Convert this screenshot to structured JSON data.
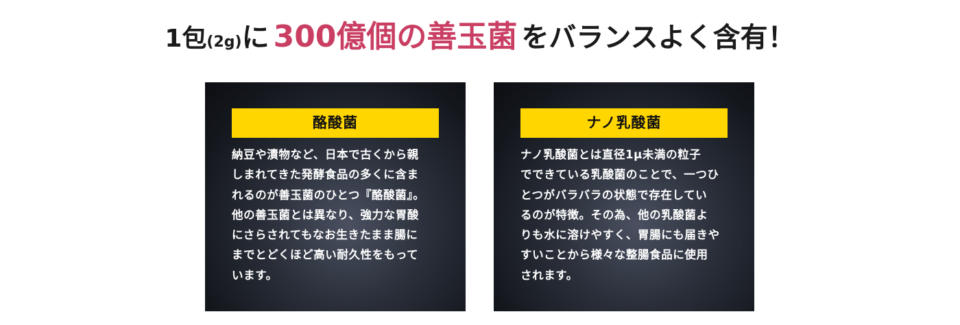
{
  "headline": {
    "part1": "1包",
    "part2": "(2g)",
    "part3": "に",
    "accent": "300億個の善玉菌",
    "part4": "をバランスよく含有！"
  },
  "colors": {
    "accent": "#c93e62",
    "title_bar": "#ffd600",
    "card_bg": "#14171d"
  },
  "cards": [
    {
      "title": "酪酸菌",
      "lines": [
        "納豆や漬物など、日本で古くから親",
        "しまれてきた発酵食品の多くに含ま",
        "れるのが善玉菌のひとつ『酪酸菌』。",
        "他の善玉菌とは異なり、強力な胃酸",
        "にさらされてもなお生きたまま腸に",
        "までとどくほど高い耐久性をもって",
        "います。"
      ]
    },
    {
      "title": "ナノ乳酸菌",
      "lines": [
        "ナノ乳酸菌とは直径1μ未満の粒子",
        "でできている乳酸菌のことで、一つひ",
        "とつがバラバラの状態で存在してい",
        "るのが特徴。その為、他の乳酸菌よ",
        "りも水に溶けやすく、胃腸にも届きや",
        "すいことから様々な整腸食品に使用",
        "されます。"
      ]
    }
  ]
}
